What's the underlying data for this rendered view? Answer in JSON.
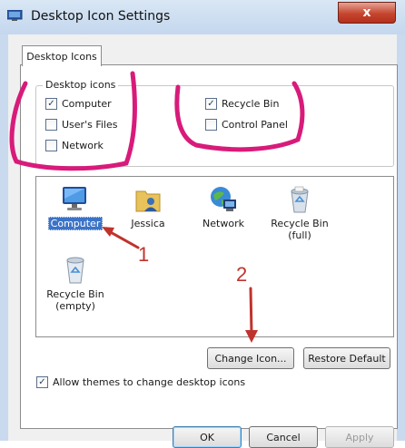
{
  "window": {
    "title": "Desktop Icon Settings",
    "close_symbol": "x"
  },
  "tab": {
    "label": "Desktop Icons"
  },
  "desktop_icons_group": {
    "title": "Desktop icons",
    "checkboxes": [
      {
        "label": "Computer",
        "checked": true
      },
      {
        "label": "User's Files",
        "checked": false
      },
      {
        "label": "Network",
        "checked": false
      },
      {
        "label": "Recycle Bin",
        "checked": true
      },
      {
        "label": "Control Panel",
        "checked": false
      }
    ]
  },
  "icon_list": {
    "items": [
      {
        "label": "Computer",
        "selected": true,
        "icon": "computer-icon"
      },
      {
        "label": "Jessica",
        "selected": false,
        "icon": "user-folder-icon"
      },
      {
        "label": "Network",
        "selected": false,
        "icon": "network-icon"
      },
      {
        "label": "Recycle Bin\n(full)",
        "line1": "Recycle Bin",
        "line2": "(full)",
        "selected": false,
        "icon": "recycle-bin-full-icon"
      },
      {
        "label": "Recycle Bin\n(empty)",
        "line1": "Recycle Bin",
        "line2": "(empty)",
        "selected": false,
        "icon": "recycle-bin-empty-icon"
      }
    ]
  },
  "buttons": {
    "change_icon": "Change Icon...",
    "restore_default": "Restore Default",
    "ok": "OK",
    "cancel": "Cancel",
    "apply": "Apply"
  },
  "themes_checkbox": {
    "label": "Allow themes to change desktop icons",
    "checked": true
  },
  "annotations": {
    "number_1": "1",
    "number_2": "2",
    "color": "#c0332c",
    "circle_color": "#d81b7a"
  },
  "colors": {
    "selection": "#3b73c7",
    "title_bar": "#c4d7ee",
    "close_button": "#c6452f"
  }
}
